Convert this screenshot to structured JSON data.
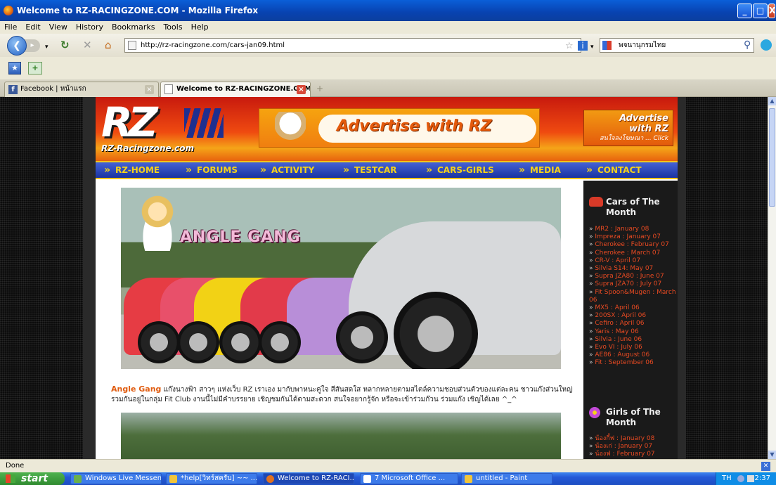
{
  "window": {
    "title": "Welcome to RZ-RACINGZONE.COM - Mozilla Firefox",
    "controls": [
      "_",
      "□",
      "X"
    ]
  },
  "menu": [
    "File",
    "Edit",
    "View",
    "History",
    "Bookmarks",
    "Tools",
    "Help"
  ],
  "navbar": {
    "url": "http://rz-racingzone.com/cars-jan09.html",
    "search_value": "พจนานุกรมไทย"
  },
  "tabs": [
    {
      "label": "Facebook | หน้าแรก",
      "active": false
    },
    {
      "label": "Welcome to RZ-RACINGZONE.COM",
      "active": true
    }
  ],
  "site": {
    "logo_text": "RZ",
    "logo_site": "RZ-Racingzone.com",
    "ad_big": "Advertise with RZ",
    "ad_small_1": "Advertise",
    "ad_small_2": "with RZ",
    "ad_small_3": "สนใจลงโฆษณา ... Click",
    "nav": [
      "RZ-HOME",
      "FORUMS",
      "ACTIVITY",
      "TESTCAR",
      "CARS-GIRLS",
      "MEDIA",
      "CONTACT"
    ],
    "photo_title": "ANGLE GANG",
    "description_lead": "Angle Gang",
    "description_body": " แก๊งนางฟ้า สาวๆ แห่งเว็บ RZ เราเอง มากับพาหนะคู่ใจ สีสันสดใส หลากหลายตามสไตล์ความชอบส่วนตัวของแต่ละคน ชาวแก๊งส่วนใหญ่รวมกันอยู่ในกลุ่ม Fit Club งานนี้ไม่มีคำบรรยาย เชิญชมกันได้ตามสะดวก สนใจอยากรู้จัก หรือจะเข้าร่วมก๊วน ร่วมแก๊ง เชิญได้เลย ^_^"
  },
  "sidebar": {
    "cars_heading": "Cars of The Month",
    "cars": [
      "MR2 : January 08",
      "Impreza : January 07",
      "Cherokee : February 07",
      "Cherokee : March 07",
      "CR-V : April 07",
      "Silvia S14: May 07",
      "Supra JZA80 : June 07",
      "Supra JZA70 : July 07",
      "Fit Spoon&Mugen : March 06",
      "MX5 : April 06",
      "200SX : April 06",
      "Cefiro : April 06",
      "Yaris : May 06",
      "Silvia : June 06",
      "Evo VI : July 06",
      "AE86 : August 06",
      "Fit : September 06"
    ],
    "girls_heading": "Girls of The Month",
    "girls": [
      "น้องกี้ฟ : January 08",
      "น้องเก่ : January 07",
      "น้องฟ่ : February 07"
    ]
  },
  "status": {
    "text": "Done"
  },
  "taskbar": {
    "start": "start",
    "tasks": [
      "Windows Live Messen...",
      "*help[วิทร์สครับ] ~~ ...",
      "Welcome to RZ-RACI...",
      "7 Microsoft Office ...",
      "untitled - Paint"
    ],
    "lang": "TH",
    "clock": "2:37"
  }
}
